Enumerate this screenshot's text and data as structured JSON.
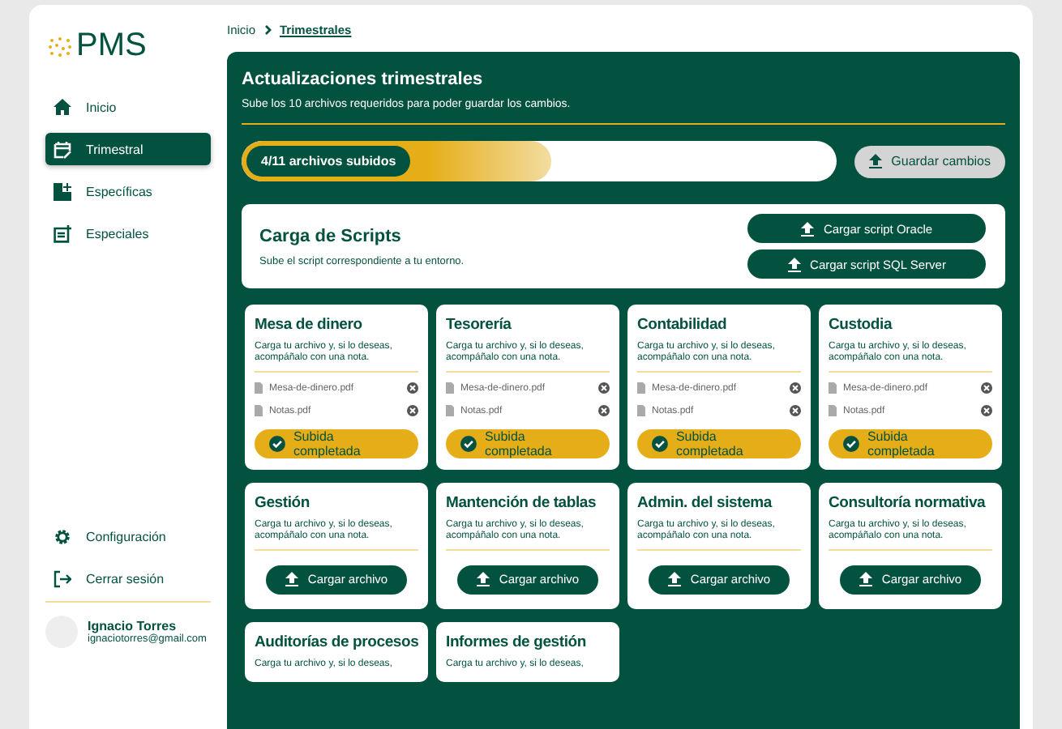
{
  "logo": {
    "text": "PMS"
  },
  "sidebar": {
    "items": [
      {
        "label": "Inicio",
        "selected": false
      },
      {
        "label": "Trimestral",
        "selected": true
      },
      {
        "label": "Específicas",
        "selected": false
      },
      {
        "label": "Especiales",
        "selected": false
      }
    ],
    "footer_items": [
      {
        "label": "Configuración"
      },
      {
        "label": "Cerrar sesión"
      }
    ],
    "user": {
      "name": "Ignacio Torres",
      "email": "ignaciotorres@gmail.com"
    }
  },
  "breadcrumb": [
    "Inicio",
    "Trimestrales"
  ],
  "header": {
    "title": "Actualizaciones trimestrales",
    "subtitle": "Sube los 10 archivos requeridos para poder guardar los cambios."
  },
  "progress": {
    "label": "4/11 archivos subidos",
    "level": 0.52
  },
  "save_button": {
    "label": "Guardar cambios",
    "disabled": true
  },
  "scripts": {
    "title": "Carga de Scripts",
    "subtitle": "Sube el script correspondiente a tu entorno.",
    "buttons": [
      "Cargar script Oracle",
      "Cargar script SQL Server"
    ]
  },
  "cards": [
    {
      "kind": "uploaded",
      "title": "Mesa de dinero",
      "description": "Carga tu archivo y, si lo deseas, acompáñalo con una nota.",
      "files": [
        "Mesa-de-dinero.pdf",
        "Notas.pdf"
      ],
      "status": "Subida completada"
    },
    {
      "kind": "uploaded",
      "title": "Tesorería",
      "description": "Carga tu archivo y, si lo deseas, acompáñalo con una nota.",
      "files": [
        "Mesa-de-dinero.pdf",
        "Notas.pdf"
      ],
      "status": "Subida completada"
    },
    {
      "kind": "uploaded",
      "title": "Contabilidad",
      "description": "Carga tu archivo y, si lo deseas, acompáñalo con una nota.",
      "files": [
        "Mesa-de-dinero.pdf",
        "Notas.pdf"
      ],
      "status": "Subida completada"
    },
    {
      "kind": "uploaded",
      "title": "Custodia",
      "description": "Carga tu archivo y, si lo deseas, acompáñalo con una nota.",
      "files": [
        "Mesa-de-dinero.pdf",
        "Notas.pdf"
      ],
      "status": "Subida completada"
    },
    {
      "kind": "pending",
      "title": "Gestión",
      "description": "Carga tu archivo y, si lo deseas, acompáñalo con una nota.",
      "button": "Cargar archivo"
    },
    {
      "kind": "pending",
      "title": "Mantención de tablas",
      "description": "Carga tu archivo y, si lo deseas, acompáñalo con una nota.",
      "button": "Cargar archivo"
    },
    {
      "kind": "pending",
      "title": "Admin. del sistema",
      "description": "Carga tu archivo y, si lo deseas, acompáñalo con una nota.",
      "button": "Cargar archivo"
    },
    {
      "kind": "pending",
      "title": "Consultoría normativa",
      "description": "Carga tu archivo y, si lo deseas, acompáñalo con una nota.",
      "button": "Cargar archivo"
    },
    {
      "kind": "pending",
      "title": "Auditorías de procesos",
      "description": "Carga tu archivo y, si lo deseas,"
    },
    {
      "kind": "pending",
      "title": "Informes de gestión",
      "description": "Carga tu archivo y, si lo deseas,"
    }
  ]
}
